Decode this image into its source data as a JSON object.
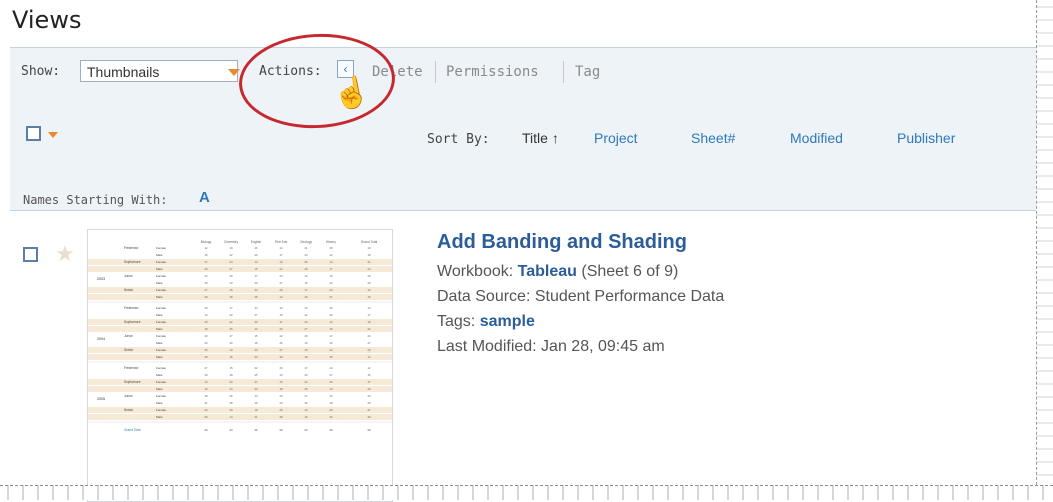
{
  "page": {
    "title": "Views"
  },
  "toolbar": {
    "show_label": "Show:",
    "show_value": "Thumbnails",
    "actions_label": "Actions:",
    "back_glyph": "‹",
    "actions": [
      "Delete",
      "Permissions",
      "Tag"
    ],
    "sort_label": "Sort By:",
    "sort_options": [
      "Title ↑",
      "Project",
      "Sheet#",
      "Modified",
      "Publisher"
    ],
    "names_label": "Names Starting With:",
    "names_letter": "A"
  },
  "view": {
    "title": "Add Banding and Shading",
    "workbook_label": "Workbook:",
    "workbook": "Tableau",
    "sheet": "(Sheet 6 of 9)",
    "data_source": "Data Source: Student Performance Data",
    "tags_label": "Tags:",
    "tag": "sample",
    "last_modified": "Last Modified: Jan 28, 09:45 am"
  },
  "chart_data": {
    "type": "table",
    "columns": [
      "Biology",
      "Chemistry",
      "English",
      "Fine Arts",
      "Geology",
      "History",
      "Grand Total"
    ],
    "years": [
      "2003",
      "2004",
      "2005"
    ],
    "levels": [
      "Freshman",
      "Sophomore",
      "Junior",
      "Senior"
    ],
    "genders": [
      "Female",
      "Male"
    ],
    "footer": "Grand Total"
  },
  "colors": {
    "accent": "#2c5d9a",
    "link": "#2f78b9",
    "highlight_ring": "#c7282e",
    "toolbar_bg": "#eef3f8",
    "band": "#f6ead6"
  },
  "icons": {
    "hand_cursor": "pointer-hand-icon",
    "favorite": "star-icon",
    "selector": "checkbox-icon",
    "dropdown": "chevron-down-icon"
  }
}
